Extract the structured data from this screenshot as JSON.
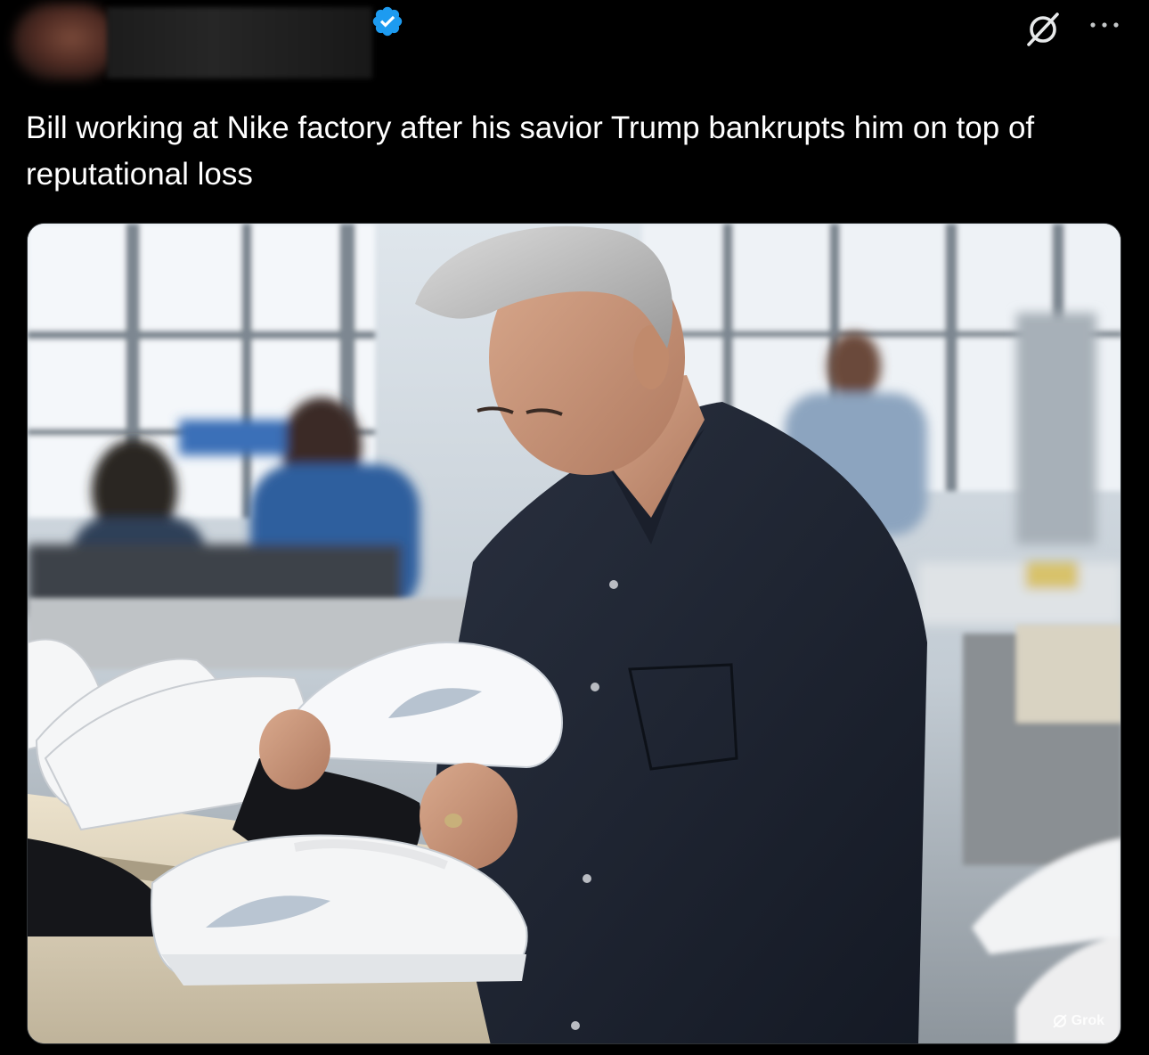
{
  "post": {
    "text": "Bill working at Nike factory after his savior Trump bankrupts him on top of  reputational loss",
    "author": {
      "verified": true
    },
    "actions": {
      "grok_icon": "grok-icon",
      "more_icon": "more-icon"
    },
    "media": {
      "watermark_text": "Grok",
      "watermark_icon": "grok-icon"
    }
  },
  "colors": {
    "background": "#000000",
    "text": "#ffffff",
    "verified_badge": "#1d9bf0",
    "icon": "#e7e9ea"
  }
}
